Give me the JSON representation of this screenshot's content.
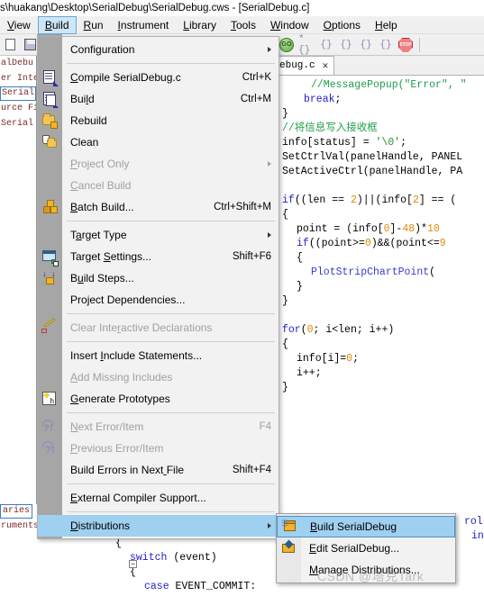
{
  "window": {
    "title": "s\\huakang\\Desktop\\SerialDebug\\SerialDebug.cws - [SerialDebug.c]"
  },
  "menubar": {
    "items": [
      {
        "label": "View",
        "mnemonic": "V",
        "active": false
      },
      {
        "label": "Build",
        "mnemonic": "B",
        "active": true
      },
      {
        "label": "Run",
        "mnemonic": "R",
        "active": false
      },
      {
        "label": "Instrument",
        "mnemonic": "I",
        "active": false
      },
      {
        "label": "Library",
        "mnemonic": "L",
        "active": false
      },
      {
        "label": "Tools",
        "mnemonic": "T",
        "active": false
      },
      {
        "label": "Window",
        "mnemonic": "W",
        "active": false
      },
      {
        "label": "Options",
        "mnemonic": "O",
        "active": false
      },
      {
        "label": "Help",
        "mnemonic": "H",
        "active": false
      }
    ]
  },
  "toolbar": {
    "go_label": "GO",
    "stop_label": "STOP",
    "step_icons": [
      "*{}",
      "{}",
      "{}",
      "{}",
      "{}"
    ]
  },
  "build_menu": {
    "items": [
      {
        "label": "Configuration",
        "accel": "",
        "submenu": true,
        "disabled": false,
        "highlight": false,
        "icon": "none"
      },
      {
        "sep": true
      },
      {
        "label": "Compile SerialDebug.c",
        "accel": "Ctrl+K",
        "submenu": false,
        "disabled": false,
        "highlight": false,
        "icon": "compile-icon"
      },
      {
        "label": "Build",
        "accel": "Ctrl+M",
        "submenu": false,
        "disabled": false,
        "highlight": false,
        "icon": "build-icon"
      },
      {
        "label": "Rebuild",
        "accel": "",
        "submenu": false,
        "disabled": false,
        "highlight": false,
        "icon": "rebuild-icon"
      },
      {
        "label": "Clean",
        "accel": "",
        "submenu": false,
        "disabled": false,
        "highlight": false,
        "icon": "clean-icon"
      },
      {
        "label": "Project Only",
        "accel": "",
        "submenu": true,
        "disabled": true,
        "highlight": false,
        "icon": "none"
      },
      {
        "label": "Cancel Build",
        "accel": "",
        "submenu": false,
        "disabled": true,
        "highlight": false,
        "icon": "none"
      },
      {
        "label": "Batch Build...",
        "accel": "Ctrl+Shift+M",
        "submenu": false,
        "disabled": false,
        "highlight": false,
        "icon": "batch-build-icon"
      },
      {
        "sep": true
      },
      {
        "label": "Target Type",
        "accel": "",
        "submenu": true,
        "disabled": false,
        "highlight": false,
        "icon": "none"
      },
      {
        "label": "Target Settings...",
        "accel": "Shift+F6",
        "submenu": false,
        "disabled": false,
        "highlight": false,
        "icon": "target-settings-icon"
      },
      {
        "label": "Build Steps...",
        "accel": "",
        "submenu": false,
        "disabled": false,
        "highlight": false,
        "icon": "build-steps-icon"
      },
      {
        "label": "Project Dependencies...",
        "accel": "",
        "submenu": false,
        "disabled": false,
        "highlight": false,
        "icon": "none"
      },
      {
        "sep": true
      },
      {
        "label": "Clear Interactive Declarations",
        "accel": "",
        "submenu": false,
        "disabled": true,
        "highlight": false,
        "icon": "clear-declarations-icon"
      },
      {
        "sep": true
      },
      {
        "label": "Insert Include Statements...",
        "accel": "",
        "submenu": false,
        "disabled": false,
        "highlight": false,
        "icon": "none"
      },
      {
        "label": "Add Missing Includes",
        "accel": "",
        "submenu": false,
        "disabled": true,
        "highlight": false,
        "icon": "none"
      },
      {
        "label": "Generate Prototypes",
        "accel": "",
        "submenu": false,
        "disabled": false,
        "highlight": false,
        "icon": "generate-prototypes-icon"
      },
      {
        "sep": true
      },
      {
        "label": "Next Error/Item",
        "accel": "F4",
        "submenu": false,
        "disabled": true,
        "highlight": false,
        "icon": "next-error-icon"
      },
      {
        "label": "Previous Error/Item",
        "accel": "",
        "submenu": false,
        "disabled": true,
        "highlight": false,
        "icon": "previous-error-icon"
      },
      {
        "label": "Build Errors in Next File",
        "accel": "Shift+F4",
        "submenu": false,
        "disabled": false,
        "highlight": false,
        "icon": "none"
      },
      {
        "sep": true
      },
      {
        "label": "External Compiler Support...",
        "accel": "",
        "submenu": false,
        "disabled": false,
        "highlight": false,
        "icon": "none"
      },
      {
        "sep": true
      },
      {
        "label": "Distributions",
        "accel": "",
        "submenu": true,
        "disabled": false,
        "highlight": true,
        "icon": "none"
      }
    ],
    "mnemonics": {
      "Configuration": 5,
      "Compile SerialDebug.c": 0,
      "Build": 3,
      "Project Only": 0,
      "Cancel Build": 0,
      "Batch Build...": 0,
      "Target Type": 1,
      "Target Settings...": 7,
      "Build Steps...": 1,
      "Project Dependencies...": 3,
      "Clear Interactive Declarations": 10,
      "Insert Include Statements...": 7,
      "Add Missing Includes": 0,
      "Generate Prototypes": 0,
      "Next Error/Item": 0,
      "Previous Error/Item": 0,
      "Build Errors in Next File": 20,
      "External Compiler Support...": 0,
      "Distributions": 0
    }
  },
  "distributions_submenu": {
    "items": [
      {
        "label": "Build SerialDebug",
        "highlight": true,
        "icon": "package-build-icon",
        "mnemonic": 0
      },
      {
        "label": "Edit SerialDebug...",
        "highlight": false,
        "icon": "package-edit-icon",
        "mnemonic": 0
      },
      {
        "label": "Manage Distributions...",
        "highlight": false,
        "icon": "none",
        "mnemonic": 0
      }
    ]
  },
  "project_tree": {
    "rows": [
      {
        "text": "alDebu",
        "selected": false
      },
      {
        "text": "er Inte",
        "selected": false
      },
      {
        "text": "Serial",
        "selected": true
      },
      {
        "text": "urce Fi",
        "selected": false
      },
      {
        "text": "Serial",
        "selected": false
      }
    ],
    "bottom_rows": [
      {
        "text": "aries",
        "selected": true
      },
      {
        "text": "ruments",
        "selected": false
      }
    ]
  },
  "editor": {
    "tab_label": "ebug.c",
    "close_label": "✕",
    "lines": [
      {
        "indent": 4,
        "segs": [
          {
            "t": "//MessagePopup(\"Error\", \"",
            "c": "cmt"
          }
        ]
      },
      {
        "indent": 3,
        "segs": [
          {
            "t": "break",
            "c": "kw"
          },
          {
            "t": ";",
            "c": ""
          }
        ]
      },
      {
        "indent": 0,
        "segs": [
          {
            "t": "}",
            "c": ""
          }
        ]
      },
      {
        "indent": 0,
        "segs": [
          {
            "t": "//将信息写入接收框",
            "c": "cmt"
          }
        ]
      },
      {
        "indent": 0,
        "segs": [
          {
            "t": "info[status] = ",
            "c": ""
          },
          {
            "t": "'\\0'",
            "c": "str"
          },
          {
            "t": ";",
            "c": ""
          }
        ]
      },
      {
        "indent": 0,
        "segs": [
          {
            "t": "SetCtrlVal(panelHandle, PANEL",
            "c": ""
          }
        ]
      },
      {
        "indent": 0,
        "segs": [
          {
            "t": "SetActiveCtrl(panelHandle, PA",
            "c": ""
          }
        ]
      },
      {
        "indent": 0,
        "segs": [
          {
            "t": "",
            "c": ""
          }
        ]
      },
      {
        "indent": 0,
        "segs": [
          {
            "t": "if",
            "c": "kw"
          },
          {
            "t": "((len == ",
            "c": ""
          },
          {
            "t": "2",
            "c": "num"
          },
          {
            "t": ")||(info[",
            "c": ""
          },
          {
            "t": "2",
            "c": "num"
          },
          {
            "t": "] == ",
            "c": ""
          },
          {
            "t": "(",
            "c": ""
          }
        ]
      },
      {
        "indent": 0,
        "segs": [
          {
            "t": "{",
            "c": ""
          }
        ]
      },
      {
        "indent": 2,
        "segs": [
          {
            "t": "point = (info[",
            "c": ""
          },
          {
            "t": "0",
            "c": "num"
          },
          {
            "t": "]-",
            "c": ""
          },
          {
            "t": "48",
            "c": "num"
          },
          {
            "t": ")*",
            "c": ""
          },
          {
            "t": "10",
            "c": "num"
          }
        ]
      },
      {
        "indent": 2,
        "segs": [
          {
            "t": "if",
            "c": "kw"
          },
          {
            "t": "((point>=",
            "c": ""
          },
          {
            "t": "0",
            "c": "num"
          },
          {
            "t": ")&&(point<=",
            "c": ""
          },
          {
            "t": "9",
            "c": "num"
          }
        ]
      },
      {
        "indent": 2,
        "segs": [
          {
            "t": "{",
            "c": ""
          }
        ]
      },
      {
        "indent": 4,
        "segs": [
          {
            "t": "PlotStripChartPoint",
            "c": "fn"
          },
          {
            "t": "(",
            "c": ""
          }
        ]
      },
      {
        "indent": 2,
        "segs": [
          {
            "t": "}",
            "c": ""
          }
        ]
      },
      {
        "indent": 0,
        "segs": [
          {
            "t": "}",
            "c": ""
          }
        ]
      },
      {
        "indent": 0,
        "segs": [
          {
            "t": "",
            "c": ""
          }
        ]
      },
      {
        "indent": 0,
        "segs": [
          {
            "t": "for",
            "c": "kw"
          },
          {
            "t": "(",
            "c": ""
          },
          {
            "t": "0",
            "c": "num"
          },
          {
            "t": "; i<len; i++)",
            "c": ""
          }
        ]
      },
      {
        "indent": 0,
        "segs": [
          {
            "t": "{",
            "c": ""
          }
        ]
      },
      {
        "indent": 2,
        "segs": [
          {
            "t": "info[i]=",
            "c": ""
          },
          {
            "t": "0",
            "c": "num"
          },
          {
            "t": ";",
            "c": ""
          }
        ]
      },
      {
        "indent": 2,
        "segs": [
          {
            "t": "i++;",
            "c": ""
          }
        ]
      },
      {
        "indent": 0,
        "segs": [
          {
            "t": "}",
            "c": ""
          }
        ]
      }
    ],
    "right_fragment_lines": [
      "rol",
      "in"
    ]
  },
  "bottom_code": {
    "lines": [
      {
        "indent": 1,
        "segs": [
          {
            "t": "{",
            "c": ""
          }
        ]
      },
      {
        "indent": 3,
        "segs": [
          {
            "t": "switch",
            "c": "kw"
          },
          {
            "t": " (event)",
            "c": ""
          }
        ]
      },
      {
        "indent": 3,
        "segs": [
          {
            "t": "{",
            "c": ""
          }
        ]
      },
      {
        "indent": 5,
        "segs": [
          {
            "t": "case",
            "c": "kw"
          },
          {
            "t": " EVENT_COMMIT:",
            "c": ""
          }
        ]
      }
    ],
    "fold_marker": "−"
  },
  "watermark": {
    "text": "CSDN @塔克Tark"
  },
  "colors": {
    "menu_bg": "#f2f2f2",
    "menu_icon_col": "#a6a6a6",
    "highlight": "#9fd0f0",
    "menubar_active": "#cde6f7",
    "comment_green": "#1f9e4b",
    "keyword_blue": "#2222cc",
    "number_orange": "#e08a00"
  }
}
